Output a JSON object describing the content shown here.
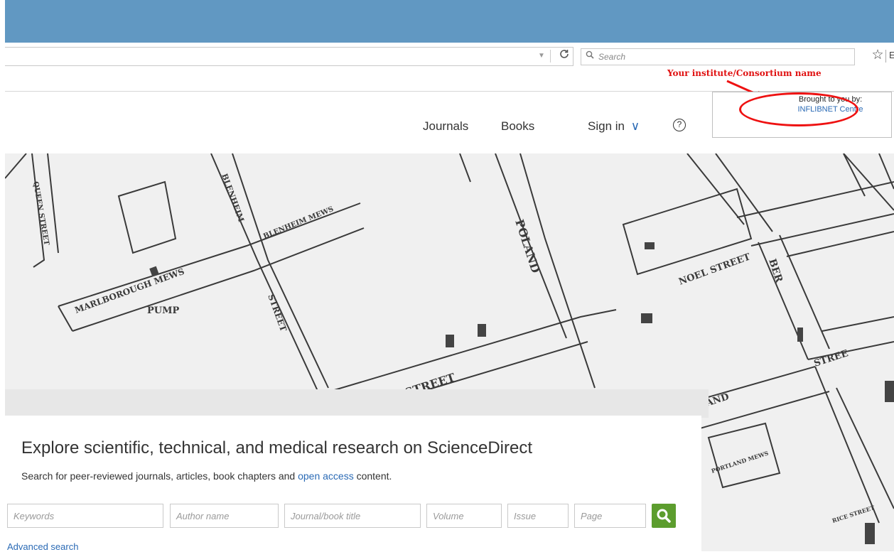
{
  "browser": {
    "search_placeholder": "Search",
    "dropdown_glyph": "▼",
    "reload_glyph": "C",
    "star_glyph": "☆",
    "edge_glyph": "E"
  },
  "annotation": {
    "text": "Your institute/Consortium name",
    "color": "#e01010"
  },
  "institution": {
    "line1": "Brought to you by:",
    "line2": "INFLIBNET Centre"
  },
  "nav": {
    "journals": "Journals",
    "books": "Books",
    "sign_in": "Sign in",
    "sign_in_chevron": "∨",
    "help": "?"
  },
  "map_labels": {
    "queen_street": "QUEEN STREET",
    "blenheim": "BLENHEIM",
    "blenheim_mews": "BLENHEIM MEWS",
    "marlborough_mews": "MARLBOROUGH MEWS",
    "pump": "PUMP",
    "street_vertical": "STREET",
    "marlborough_street": "OROUGH STREET",
    "poland": "POLAND",
    "noel_street": "NOEL STREET",
    "berners": "BER",
    "street_right": "STREE",
    "portland_street": "RTLAND",
    "portland_mews": "PORTLAND MEWS",
    "rice_street": "RICE STREET"
  },
  "hero": {
    "heading": "Explore scientific, technical, and medical research on ScienceDirect",
    "sub_prefix": "Search for peer-reviewed journals, articles, book chapters and ",
    "sub_link": "open access",
    "sub_suffix": " content."
  },
  "search": {
    "keywords": "Keywords",
    "author": "Author name",
    "journal": "Journal/book title",
    "volume": "Volume",
    "issue": "Issue",
    "page": "Page",
    "advanced": "Advanced search"
  },
  "colors": {
    "titlebar": "#6198c2",
    "accent_green": "#5c9d2e",
    "link_blue": "#2a6ab5"
  }
}
